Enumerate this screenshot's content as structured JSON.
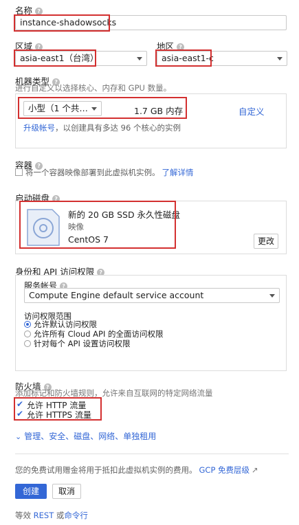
{
  "name": {
    "label": "名称",
    "value": "instance-shadowsocks"
  },
  "region": {
    "label": "区域",
    "value": "asia-east1（台湾）"
  },
  "zone": {
    "label": "地区",
    "value": "asia-east1-c"
  },
  "machine": {
    "label": "机器类型",
    "subtitle": "进行自定义以选择核心、内存和 GPU 数量。",
    "type_value": "小型（1 个共…",
    "memory": "1.7 GB 内存",
    "customize": "自定义",
    "upgrade_link": "升级帐号",
    "upgrade_text": "，以创建具有多达 96 个核心的实例"
  },
  "container": {
    "label": "容器",
    "checkbox_text": "将一个容器映像部署到此虚拟机实例。",
    "learn_more": "了解详情"
  },
  "boot_disk": {
    "label": "启动磁盘",
    "title": "新的 20 GB SSD 永久性磁盘",
    "image_label": "映像",
    "image": "CentOS 7",
    "change_button": "更改"
  },
  "identity": {
    "label": "身份和 API 访问权限",
    "service_account_label": "服务帐号",
    "service_account_value": "Compute Engine default service account",
    "scope_label": "访问权限范围",
    "scopes": [
      {
        "label": "允许默认访问权限",
        "selected": true
      },
      {
        "label": "允许所有 Cloud API 的全面访问权限",
        "selected": false
      },
      {
        "label": "针对每个 API 设置访问权限",
        "selected": false
      }
    ]
  },
  "firewall": {
    "label": "防火墙",
    "subtitle": "添加标记和防火墙规则，允许来自互联网的特定网络流量",
    "http": "允许 HTTP 流量",
    "https": "允许 HTTPS 流量"
  },
  "advanced_link": "管理、安全、磁盘、网络、单独租用",
  "footer": {
    "notice": "您的免费试用赠金将用于抵扣此虚拟机实例的费用。",
    "gcp_link": "GCP 免费层级",
    "create": "创建",
    "cancel": "取消",
    "equivalent_prefix": "等效",
    "rest": "REST",
    "or": "或",
    "cli": "命令行"
  },
  "colors": {
    "accent": "#3367d6",
    "highlight": "#d32f2f",
    "primary_button": "#3367d6"
  }
}
